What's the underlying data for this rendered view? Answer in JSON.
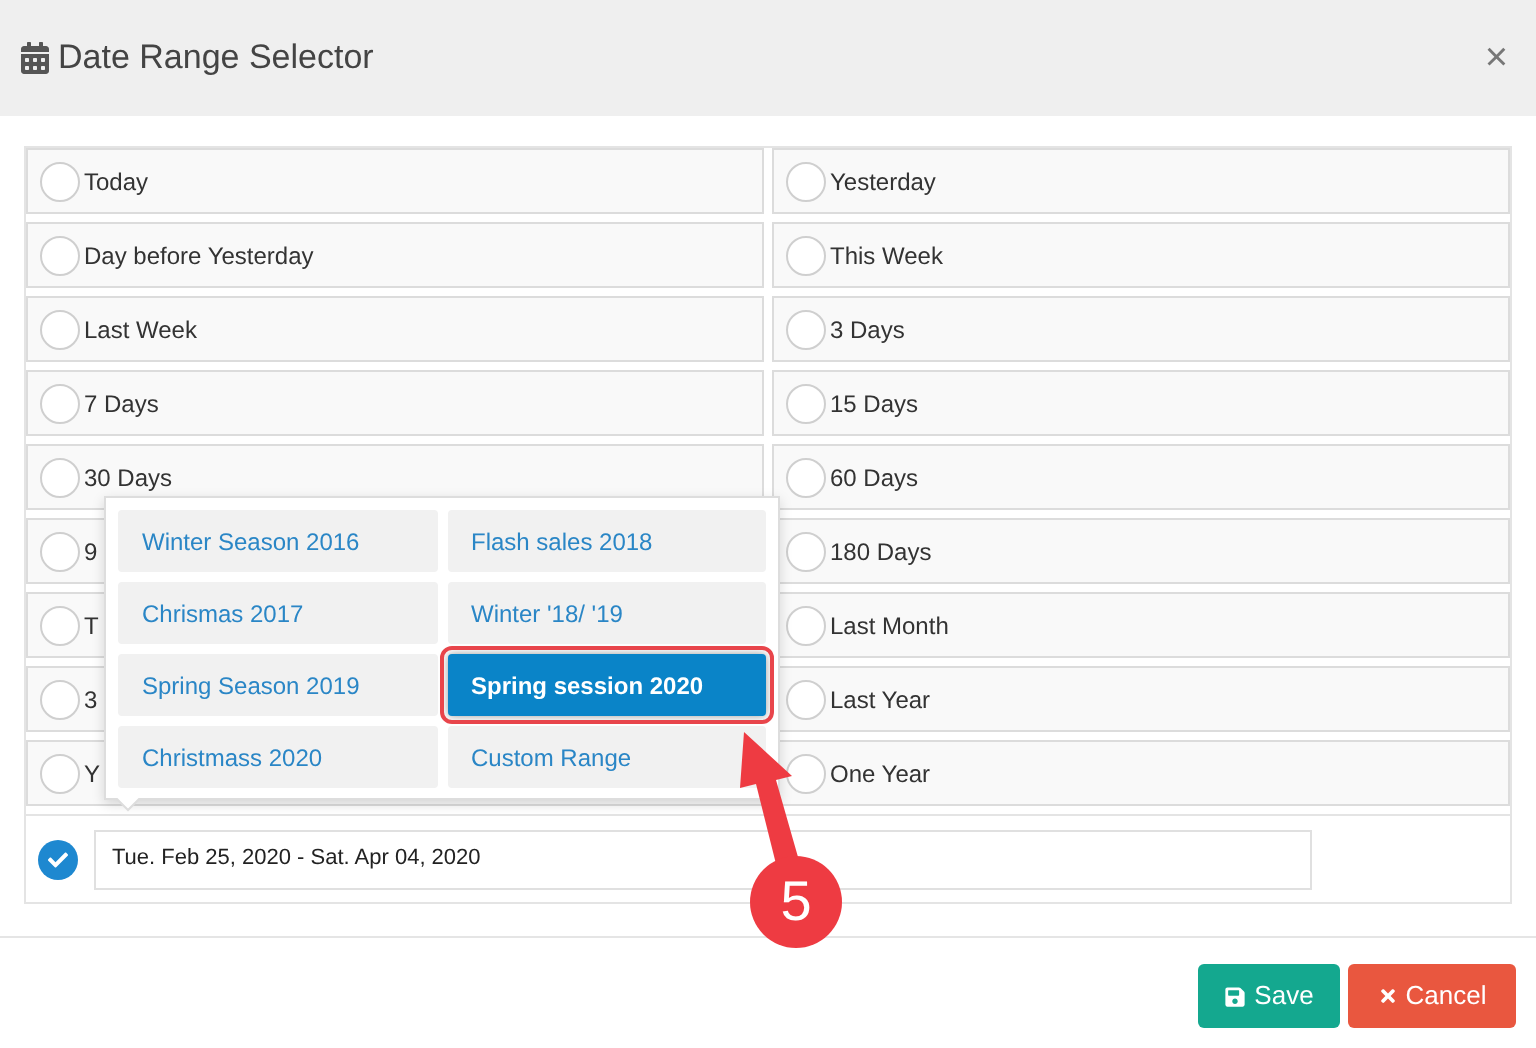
{
  "window": {
    "title": "Date Range Selector",
    "close": "×"
  },
  "options": [
    {
      "label": "Today",
      "selected": false
    },
    {
      "label": "Yesterday",
      "selected": false
    },
    {
      "label": "Day before Yesterday",
      "selected": false
    },
    {
      "label": "This Week",
      "selected": false
    },
    {
      "label": "Last Week",
      "selected": false
    },
    {
      "label": "3 Days",
      "selected": false
    },
    {
      "label": "7 Days",
      "selected": false
    },
    {
      "label": "15 Days",
      "selected": false
    },
    {
      "label": "30 Days",
      "selected": false
    },
    {
      "label": "60 Days",
      "selected": false
    },
    {
      "label": "9",
      "selected": false
    },
    {
      "label": "180 Days",
      "selected": false
    },
    {
      "label": "T",
      "selected": false
    },
    {
      "label": "Last Month",
      "selected": false
    },
    {
      "label": "3",
      "selected": false
    },
    {
      "label": "Last Year",
      "selected": false
    },
    {
      "label": "Y",
      "selected": false
    },
    {
      "label": "One Year",
      "selected": false
    }
  ],
  "custom": {
    "selected": true,
    "value": "Tue. Feb 25, 2020 - Sat. Apr 04, 2020"
  },
  "presets": [
    {
      "label": "Winter Season 2016",
      "selected": false
    },
    {
      "label": "Flash sales 2018",
      "selected": false
    },
    {
      "label": "Chrismas 2017",
      "selected": false
    },
    {
      "label": "Winter '18/ '19",
      "selected": false
    },
    {
      "label": "Spring Season 2019",
      "selected": false
    },
    {
      "label": "Spring session 2020",
      "selected": true
    },
    {
      "label": "Christmass 2020",
      "selected": false
    },
    {
      "label": "Custom Range",
      "selected": false
    }
  ],
  "annotation": {
    "step": "5"
  },
  "buttons": [
    {
      "kind": "save",
      "label": "Save"
    },
    {
      "kind": "cancel",
      "label": "Cancel"
    }
  ]
}
